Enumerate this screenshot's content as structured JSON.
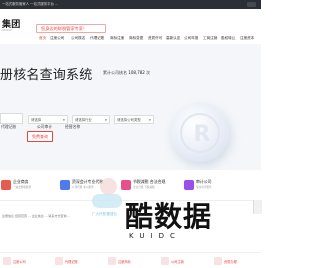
{
  "topbar": {
    "text": "一站式服务管家人 一站式服务平台 ..."
  },
  "header": {
    "logo_text": "集团",
    "logo_sub": "GROUP",
    "slogan": "您身边的财税管家专家！"
  },
  "nav": {
    "items": [
      "首页",
      "注册公司",
      "公司核名",
      "代理记账",
      "商标注册",
      "商标变更",
      "资质许可",
      "高新认定",
      "公司年报",
      "工商注销",
      "股权转让",
      "注册资本",
      "税务登记"
    ],
    "active_index": 0
  },
  "hero": {
    "title": "册核名查询系统",
    "stat_prefix": "累计公司核名",
    "stat_value": "108,782",
    "stat_suffix": "次",
    "tabs": [
      "代理记账",
      "公司审计",
      "经营名称"
    ],
    "field_city": "请选择",
    "field_industry": "请选择行业",
    "field_type": "请选择公司类型",
    "query_button": "免费查询"
  },
  "features": [
    {
      "title": "企业商务",
      "sub": "一站式财税服务",
      "color": "#e95b4f"
    },
    {
      "title": "资深会计专业代账",
      "sub": "公司代账 专人服务",
      "color": "#4f7be9"
    },
    {
      "title": "节税减税 合法合规",
      "sub": "企业合规 节税减税",
      "color": "#e94f8b"
    },
    {
      "title": "审计公司",
      "sub": "专业审计服务",
      "color": "#9b4fe9"
    }
  ],
  "footnote": "注册信息 经营范围 ... 企业信息 ... 联系方式查询 ...",
  "cards": [
    {
      "label": "注册公司"
    },
    {
      "label": "代理记账"
    },
    {
      "label": "注册商标"
    },
    {
      "label": "公司注销"
    },
    {
      "label": "资质办理"
    }
  ],
  "watermark": {
    "small_text": "广大所配置建业",
    "big_text": "酷数据",
    "latin_text": "KUIDC"
  }
}
